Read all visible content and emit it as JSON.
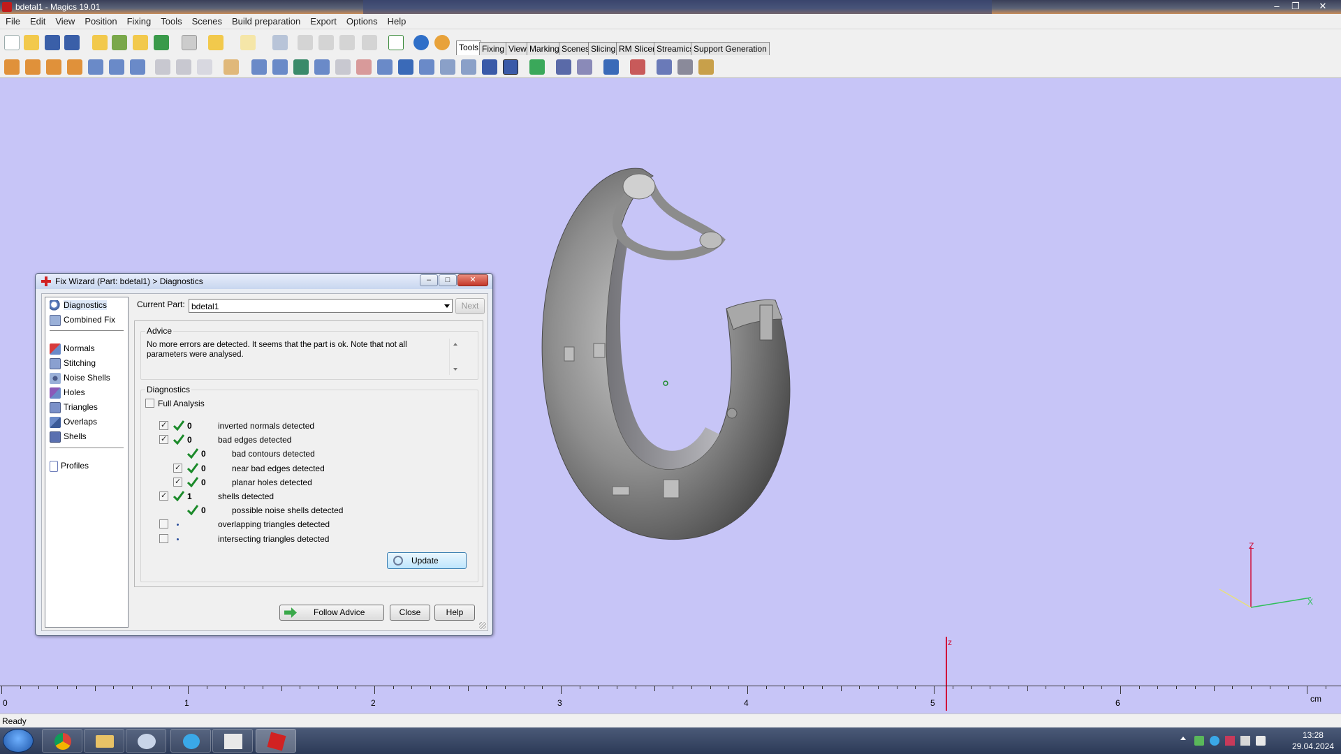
{
  "app": {
    "window_title": "bdetal1 - Magics 19.01"
  },
  "menu": [
    "File",
    "Edit",
    "View",
    "Position",
    "Fixing",
    "Tools",
    "Scenes",
    "Build preparation",
    "Export",
    "Options",
    "Help"
  ],
  "toolbar_tabs": [
    "Tools",
    "Fixing",
    "View",
    "Marking",
    "Scenes",
    "Slicing",
    "RM Slicer",
    "Streamics",
    "Support Generation"
  ],
  "active_tab": "Tools",
  "dialog": {
    "title": "Fix Wizard (Part: bdetal1) > Diagnostics",
    "nav_top": [
      {
        "label": "Diagnostics",
        "icon": "magnifier-icon"
      },
      {
        "label": "Combined Fix",
        "icon": "cube-icon"
      }
    ],
    "nav_fixes": [
      {
        "label": "Normals",
        "icon": "normals-cube-icon"
      },
      {
        "label": "Stitching",
        "icon": "stitching-cube-icon"
      },
      {
        "label": "Noise Shells",
        "icon": "noise-shells-icon"
      },
      {
        "label": "Holes",
        "icon": "holes-cube-icon"
      },
      {
        "label": "Triangles",
        "icon": "triangles-cube-icon"
      },
      {
        "label": "Overlaps",
        "icon": "overlaps-cube-icon"
      },
      {
        "label": "Shells",
        "icon": "shells-cube-icon"
      }
    ],
    "nav_bottom": [
      {
        "label": "Profiles",
        "icon": "document-icon"
      }
    ],
    "current_part_label": "Current Part:",
    "current_part_value": "bdetal1",
    "next_label": "Next",
    "advice_title": "Advice",
    "advice_text": "No more errors are detected. It seems that the part is ok. Note that not all parameters were analysed.",
    "diagnostics_title": "Diagnostics",
    "full_analysis_label": "Full Analysis",
    "rows": [
      {
        "checkbox": true,
        "checked": true,
        "status": "ok",
        "count": "0",
        "label": "inverted normals detected",
        "level": 0
      },
      {
        "checkbox": true,
        "checked": true,
        "status": "ok",
        "count": "0",
        "label": "bad edges detected",
        "level": 0
      },
      {
        "checkbox": false,
        "checked": false,
        "status": "ok",
        "count": "0",
        "label": "bad contours detected",
        "level": 1
      },
      {
        "checkbox": true,
        "checked": true,
        "status": "ok",
        "count": "0",
        "label": "near bad edges detected",
        "level": 1
      },
      {
        "checkbox": true,
        "checked": true,
        "status": "ok",
        "count": "0",
        "label": "planar holes detected",
        "level": 1
      },
      {
        "checkbox": true,
        "checked": true,
        "status": "ok",
        "count": "1",
        "label": "shells detected",
        "level": 0
      },
      {
        "checkbox": false,
        "checked": false,
        "status": "ok",
        "count": "0",
        "label": "possible noise shells detected",
        "level": 1
      },
      {
        "checkbox": true,
        "checked": false,
        "status": "pending",
        "count": "",
        "label": "overlapping triangles detected",
        "level": 0
      },
      {
        "checkbox": true,
        "checked": false,
        "status": "pending",
        "count": "",
        "label": "intersecting triangles detected",
        "level": 0
      }
    ],
    "update_label": "Update",
    "follow_advice_label": "Follow Advice",
    "close_label": "Close",
    "help_label": "Help"
  },
  "viewport": {
    "axis_labels": {
      "z": "Z",
      "x": "X"
    },
    "ruler_marker_label": "z",
    "ruler_labels": [
      "0",
      "1",
      "2",
      "3",
      "4",
      "5",
      "6"
    ],
    "ruler_unit": "cm"
  },
  "status": "Ready",
  "taskbar": {
    "time": "13:28",
    "date": "29.04.2024"
  },
  "colors": {
    "viewport_bg": "#c7c5f7",
    "model": "#8a8a8a",
    "check_green": "#1b8a2a",
    "axis_red": "#d0103a"
  }
}
